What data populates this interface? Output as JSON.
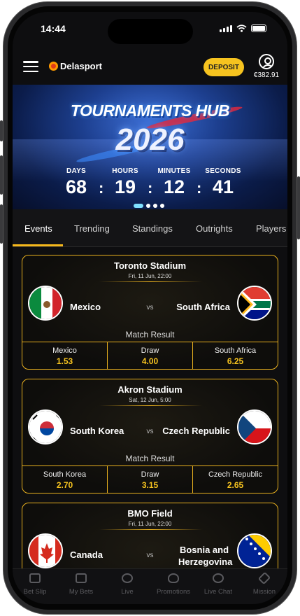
{
  "status_bar": {
    "time": "14:44"
  },
  "header": {
    "brand": "Delasport",
    "deposit_label": "DEPOSIT",
    "balance": "€382.91"
  },
  "banner": {
    "title": "TOURNAMENTS HUB",
    "year": "2026",
    "countdown": [
      {
        "label": "DAYS",
        "value": "68"
      },
      {
        "label": "HOURS",
        "value": "19"
      },
      {
        "label": "MINUTES",
        "value": "12"
      },
      {
        "label": "SECONDS",
        "value": "41"
      }
    ],
    "separator": ":"
  },
  "tabs": [
    "Events",
    "Trending",
    "Standings",
    "Outrights",
    "Players"
  ],
  "matches": [
    {
      "venue": "Toronto Stadium",
      "date": "Fri, 11 Jun, 22:00",
      "home": "Mexico",
      "away": "South Africa",
      "vs": "vs",
      "market": "Match Result",
      "odds": [
        {
          "name": "Mexico",
          "value": "1.53"
        },
        {
          "name": "Draw",
          "value": "4.00"
        },
        {
          "name": "South Africa",
          "value": "6.25"
        }
      ]
    },
    {
      "venue": "Akron Stadium",
      "date": "Sat, 12 Jun, 5:00",
      "home": "South Korea",
      "away": "Czech Republic",
      "vs": "vs",
      "market": "Match Result",
      "odds": [
        {
          "name": "South Korea",
          "value": "2.70"
        },
        {
          "name": "Draw",
          "value": "3.15"
        },
        {
          "name": "Czech Republic",
          "value": "2.65"
        }
      ]
    },
    {
      "venue": "BMO Field",
      "date": "Fri, 11 Jun, 22:00",
      "home": "Canada",
      "away": "Bosnia and Herzegovina",
      "vs": "vs"
    }
  ],
  "bottom_nav": [
    "Bet Slip",
    "My Bets",
    "Live",
    "Promotions",
    "Live Chat",
    "Mission"
  ],
  "colors": {
    "accent": "#f6c31f",
    "background": "#0e0e10",
    "card_border": "#e8b01e"
  }
}
